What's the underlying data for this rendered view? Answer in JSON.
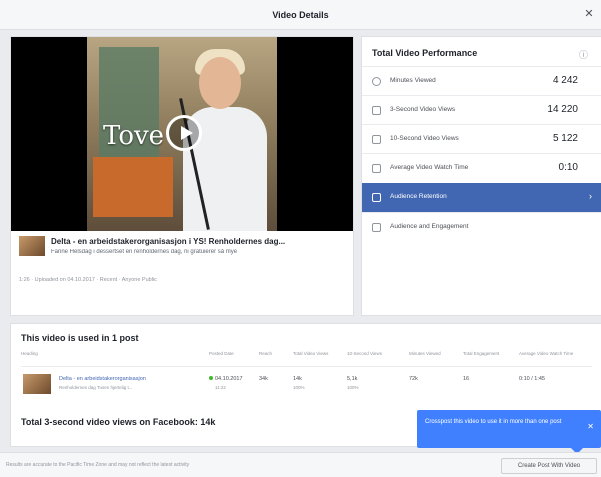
{
  "dialog": {
    "title": "Video Details",
    "close_glyph": "✕"
  },
  "video": {
    "overlay_text": "Tove",
    "post_title": "Delta - en arbeidstakerorganisasjon i YS! Renholdernes dag...",
    "post_description": "Fanne Helsdag i dessertset en renholdernes dag, ni gratuierer så mye",
    "post_info": "1:26 · Uploaded on 04.10.2017 · Recent · Anyone Public"
  },
  "performance": {
    "title": "Total Video Performance",
    "metrics": [
      {
        "label": "Minutes Viewed",
        "value": "4 242",
        "icon": "clock-icon"
      },
      {
        "label": "3-Second Video Views",
        "value": "14 220",
        "icon": "chart-bar-icon"
      },
      {
        "label": "10-Second Video Views",
        "value": "5 122",
        "icon": "chart-bar-icon"
      },
      {
        "label": "Average Video Watch Time",
        "value": "0:10",
        "icon": "timer-icon"
      },
      {
        "label": "Audience Retention",
        "value": "",
        "icon": "bars-icon",
        "active": true
      },
      {
        "label": "Audience and Engagement",
        "value": "",
        "icon": "people-icon"
      }
    ]
  },
  "posts": {
    "title": "This video is used in 1 post",
    "columns": [
      "Heading",
      "Posted Date",
      "Reach",
      "Total Video Views",
      "10-Second Views",
      "Minutes Viewed",
      "Total Engagement",
      "Average Video Watch Time"
    ],
    "rows": [
      {
        "name": "Delta - en arbeidstakerorganisasjon",
        "sub": "Renholdernes dag Tusen hjertelig t...",
        "date": "04.10.2017",
        "date_sub": "11:22",
        "reach": "34k",
        "views": "14k",
        "views_sub": "100%",
        "ten_sec": "5,1k",
        "ten_sec_sub": "100%",
        "minutes": "72k",
        "engagement": "16",
        "avg_watch": "0:10 / 1:45"
      }
    ],
    "total": "Total 3-second video views on Facebook: 14k"
  },
  "tooltip": {
    "text": "Crosspost this video to use it in more than one post",
    "close_glyph": "✕"
  },
  "footer": {
    "text": "Results are accurate to the Pacific Time Zone and may not reflect the latest activity",
    "button_label": "Create Post With Video"
  }
}
